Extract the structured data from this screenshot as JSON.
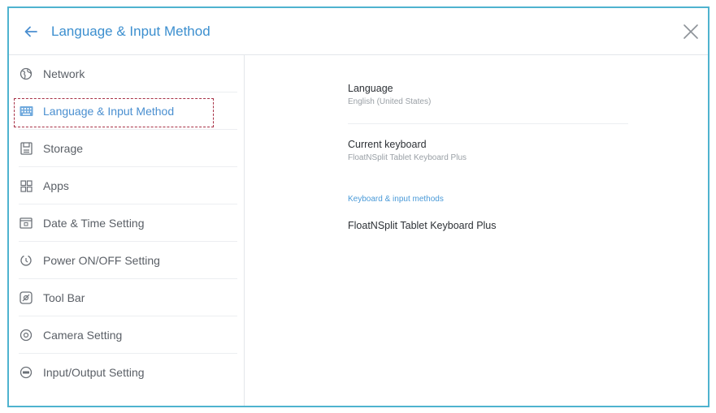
{
  "window": {
    "title": "Language & Input Method",
    "back_icon": "arrow-left-icon",
    "close_icon": "close-icon",
    "accent_color": "#3c8fcf",
    "border_color": "#4fb3cf"
  },
  "sidebar": {
    "items": [
      {
        "label": "Network",
        "icon": "globe-icon"
      },
      {
        "label": "Language & Input Method",
        "icon": "keyboard-icon",
        "selected": true
      },
      {
        "label": "Storage",
        "icon": "storage-icon"
      },
      {
        "label": "Apps",
        "icon": "apps-grid-icon"
      },
      {
        "label": "Date & Time Setting",
        "icon": "calendar-icon"
      },
      {
        "label": "Power ON/OFF Setting",
        "icon": "power-icon"
      },
      {
        "label": "Tool Bar",
        "icon": "toolbar-icon"
      },
      {
        "label": "Camera Setting",
        "icon": "camera-icon"
      },
      {
        "label": "Input/Output Setting",
        "icon": "input-output-icon"
      }
    ]
  },
  "content": {
    "language": {
      "title": "Language",
      "value": "English (United States)"
    },
    "current_keyboard": {
      "title": "Current keyboard",
      "value": "FloatNSplit Tablet Keyboard Plus"
    },
    "section_header": "Keyboard & input methods",
    "keyboard_item": {
      "title": "FloatNSplit Tablet Keyboard Plus"
    }
  }
}
